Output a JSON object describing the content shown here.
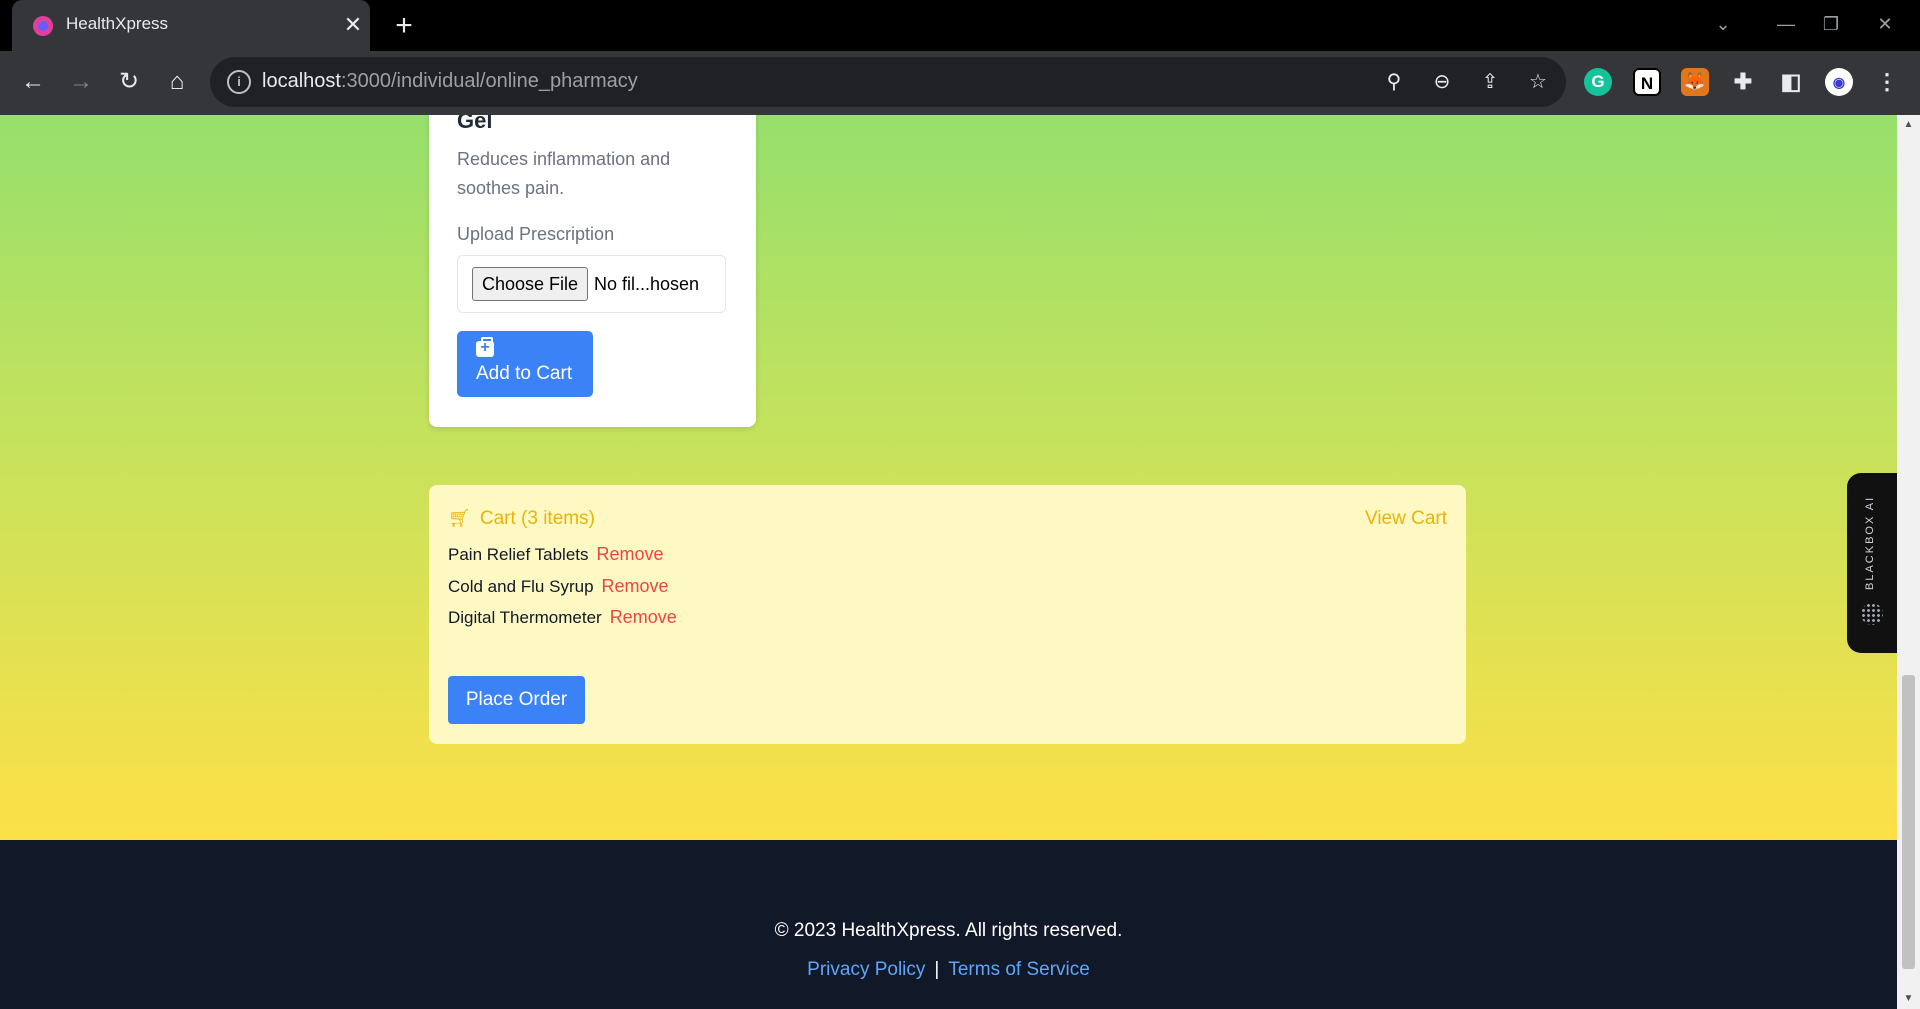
{
  "browser": {
    "tab_title": "HealthXpress",
    "tab_close": "✕",
    "new_tab": "+",
    "url_host": "localhost",
    "url_path": ":3000/individual/online_pharmacy"
  },
  "product": {
    "name": "Gel",
    "description": "Reduces inflammation and soothes pain.",
    "upload_label": "Upload Prescription",
    "file_button": "Choose File",
    "file_status": "No fil...hosen",
    "add_to_cart": "Add to Cart"
  },
  "cart": {
    "title": "Cart (3 items)",
    "view_cart": "View Cart",
    "items": [
      {
        "name": "Pain Relief Tablets",
        "remove": "Remove"
      },
      {
        "name": "Cold and Flu Syrup",
        "remove": "Remove"
      },
      {
        "name": "Digital Thermometer",
        "remove": "Remove"
      }
    ],
    "place_order": "Place Order"
  },
  "footer": {
    "copyright": "© 2023 HealthXpress. All rights reserved.",
    "privacy": "Privacy Policy",
    "separator": "|",
    "terms": "Terms of Service"
  },
  "widget": {
    "label": "BLACKBOX AI"
  },
  "colors": {
    "primary_button": "#3b82f6",
    "cart_bg": "#fef9c3",
    "cart_accent": "#eab308",
    "remove_link": "#ef4444",
    "footer_bg": "#111827",
    "footer_link": "#60a5fa"
  }
}
